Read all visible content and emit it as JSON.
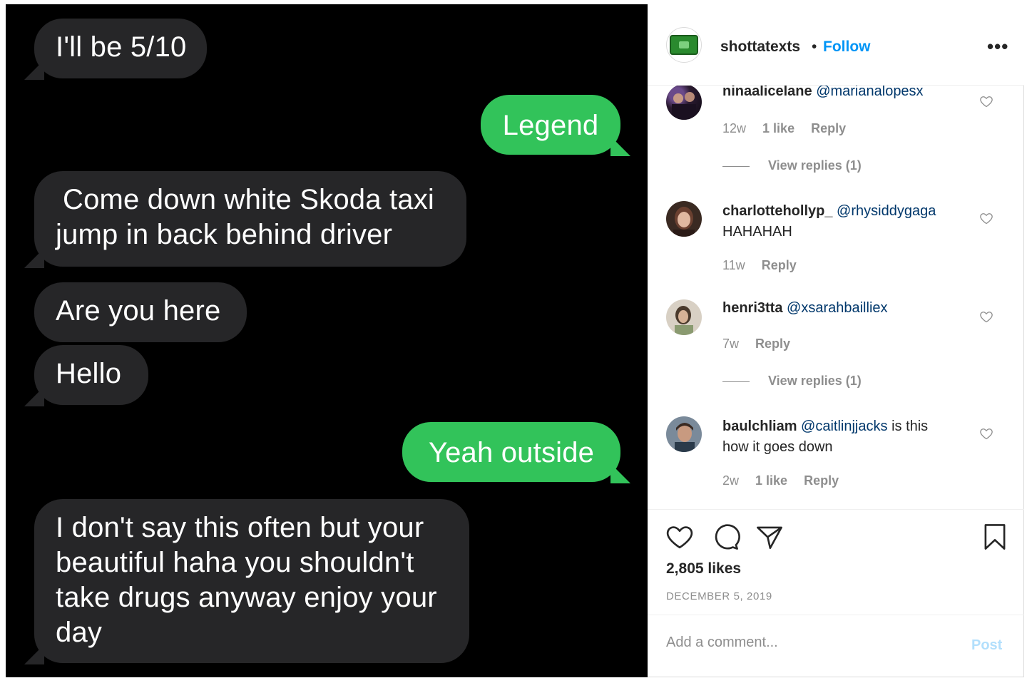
{
  "messages": [
    {
      "dir": "in",
      "text": "I'll be 5/10"
    },
    {
      "dir": "out",
      "text": "Legend"
    },
    {
      "dir": "in",
      "line1": "Come down white Skoda taxi",
      "line2": "jump in back behind driver"
    },
    {
      "dir": "in",
      "text": "Are you here"
    },
    {
      "dir": "in",
      "text": "Hello"
    },
    {
      "dir": "out",
      "text": "Yeah outside"
    },
    {
      "dir": "in",
      "line1": "I don't say this often but your",
      "line2": "beautiful haha you shouldn't",
      "line3": "take drugs anyway enjoy your",
      "line4": "day"
    }
  ],
  "header": {
    "username": "shottatexts",
    "separator": "•",
    "follow_label": "Follow",
    "more_label": "•••"
  },
  "comments": [
    {
      "username": "ninaalicelane",
      "mention": "@marianalopesx",
      "text": "",
      "time": "12w",
      "likes": "1 like",
      "reply": "Reply",
      "view_replies": "View replies (1)"
    },
    {
      "username": "charlottehollyp_",
      "mention": "@rhysiddygaga",
      "text": "HAHAHAH",
      "time": "11w",
      "reply": "Reply"
    },
    {
      "username": "henri3tta",
      "mention": "@xsarahbailliex",
      "text": "",
      "time": "7w",
      "reply": "Reply",
      "view_replies": "View replies (1)"
    },
    {
      "username": "baulchliam",
      "mention": "@caitlinjjacks",
      "text_inline": "is this",
      "text_line2": "how it goes down",
      "time": "2w",
      "likes": "1 like",
      "reply": "Reply"
    }
  ],
  "post": {
    "likes": "2,805 likes",
    "date": "DECEMBER 5, 2019"
  },
  "add_comment": {
    "placeholder": "Add a comment...",
    "post_label": "Post"
  },
  "colors": {
    "imessage_green": "#32c35a",
    "imessage_gray": "#262628",
    "link_blue": "#0095f6",
    "mention_blue": "#00376b",
    "muted": "#8e8e8e"
  },
  "icons": [
    "heart-icon",
    "comment-icon",
    "share-icon",
    "bookmark-icon",
    "more-icon",
    "small-heart-icon"
  ]
}
